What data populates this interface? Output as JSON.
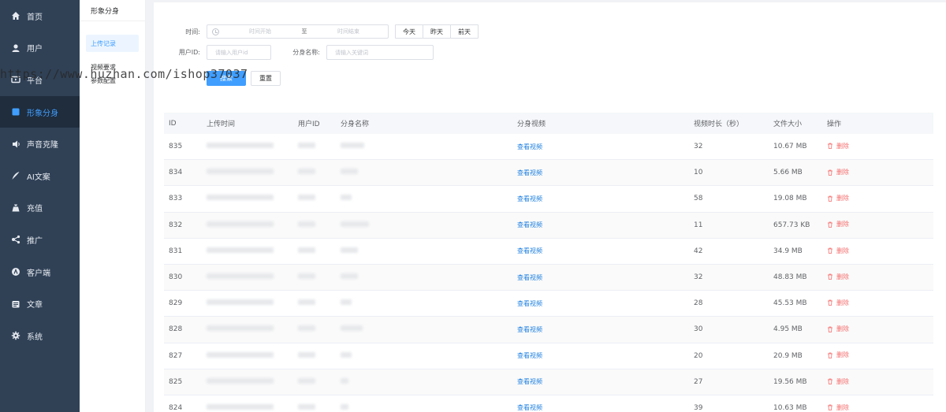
{
  "sidebar": {
    "items": [
      {
        "label": "首页",
        "icon": "home-icon"
      },
      {
        "label": "用户",
        "icon": "user-icon"
      },
      {
        "label": "平台",
        "icon": "video-icon"
      },
      {
        "label": "形象分身",
        "icon": "avatar-icon"
      },
      {
        "label": "声音克隆",
        "icon": "voice-icon"
      },
      {
        "label": "AI文案",
        "icon": "pen-icon"
      },
      {
        "label": "充值",
        "icon": "wallet-icon"
      },
      {
        "label": "推广",
        "icon": "share-icon"
      },
      {
        "label": "客户端",
        "icon": "client-icon"
      },
      {
        "label": "文章",
        "icon": "article-icon"
      },
      {
        "label": "系统",
        "icon": "gear-icon"
      }
    ],
    "active_index": 3
  },
  "subbar": {
    "title": "形象分身",
    "items": [
      "上传记录",
      "视频要求",
      "参数配置"
    ],
    "active_index": 0
  },
  "filter": {
    "time_label": "时间:",
    "start_placeholder": "时间开始",
    "range_sep": "至",
    "end_placeholder": "时间结束",
    "today": "今天",
    "yesterday": "昨天",
    "day_before": "前天",
    "uid_label": "用户ID:",
    "uid_placeholder": "请输入用户id",
    "name_label": "分身名称:",
    "name_placeholder": "请输入关键词",
    "search": "搜索",
    "reset": "重置"
  },
  "table": {
    "headers": [
      "ID",
      "上传时间",
      "用户ID",
      "分身名称",
      "分身视频",
      "视频时长（秒）",
      "文件大小",
      "操作"
    ],
    "view_label": "查看视频",
    "delete_label": "删除",
    "rows": [
      {
        "id": "835",
        "duration": "32",
        "size": "10.67 MB"
      },
      {
        "id": "834",
        "duration": "10",
        "size": "5.66 MB"
      },
      {
        "id": "833",
        "duration": "58",
        "size": "19.08 MB"
      },
      {
        "id": "832",
        "duration": "11",
        "size": "657.73 KB"
      },
      {
        "id": "831",
        "duration": "42",
        "size": "34.9 MB"
      },
      {
        "id": "830",
        "duration": "32",
        "size": "48.83 MB"
      },
      {
        "id": "829",
        "duration": "28",
        "size": "45.53 MB"
      },
      {
        "id": "828",
        "duration": "30",
        "size": "4.95 MB"
      },
      {
        "id": "827",
        "duration": "20",
        "size": "20.9 MB"
      },
      {
        "id": "825",
        "duration": "27",
        "size": "19.56 MB"
      },
      {
        "id": "824",
        "duration": "39",
        "size": "10.63 MB"
      }
    ]
  },
  "watermark": "https://www.huzhan.com/ishop37037",
  "colors": {
    "sidebar_bg": "#304156",
    "accent": "#409eff",
    "danger": "#f56c6c"
  }
}
